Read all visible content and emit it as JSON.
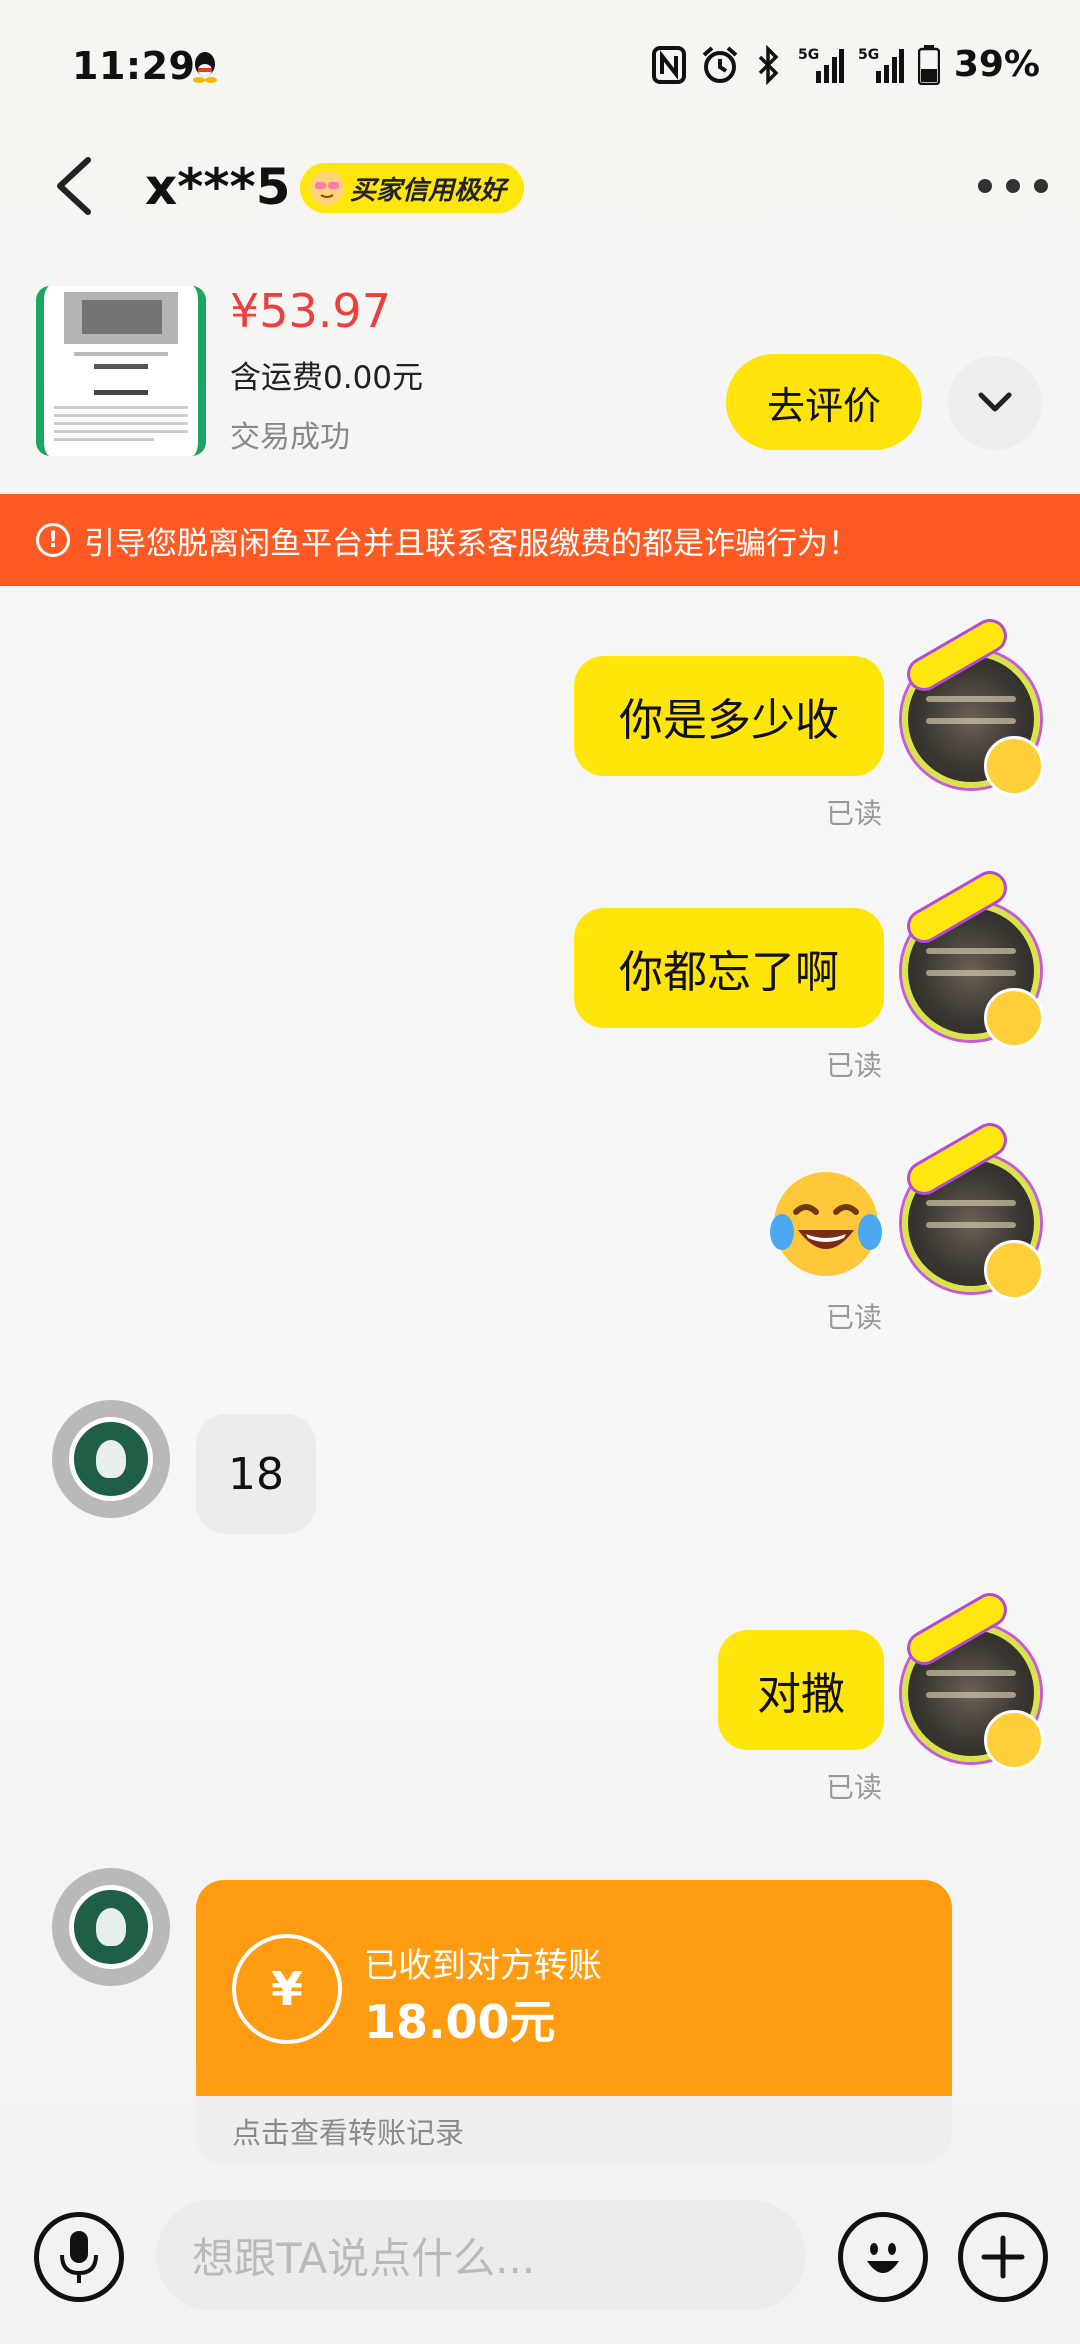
{
  "status_bar": {
    "time": "11:29",
    "icons": [
      "qq-icon",
      "nfc-icon",
      "alarm-icon",
      "bluetooth-icon",
      "5g-signal-icon",
      "5g-signal-icon",
      "battery-icon"
    ],
    "battery": "39%"
  },
  "header": {
    "nickname": "x***5",
    "credit_badge": "买家信用极好"
  },
  "product": {
    "price": "¥53.97",
    "shipping": "含运费0.00元",
    "status": "交易成功",
    "review_button": "去评价"
  },
  "warning": {
    "text": "引导您脱离闲鱼平台并且联系客服缴费的都是诈骗行为！"
  },
  "messages": [
    {
      "from": "me",
      "text": "你是多少收",
      "read": "已读"
    },
    {
      "from": "me",
      "text": "你都忘了啊",
      "read": "已读"
    },
    {
      "from": "me",
      "emoji": "😂",
      "read": "已读"
    },
    {
      "from": "other",
      "text": "18"
    },
    {
      "from": "me",
      "text": "对撒",
      "read": "已读"
    }
  ],
  "transfer": {
    "title": "已收到对方转账",
    "amount": "18.00元",
    "icon": "¥",
    "link": "点击查看转账记录"
  },
  "input_bar": {
    "placeholder": "想跟TA说点什么..."
  },
  "colors": {
    "accent": "#ffe50a",
    "warning": "#ff5a24",
    "price": "#ef3e3e",
    "transfer": "#ff9c12"
  }
}
